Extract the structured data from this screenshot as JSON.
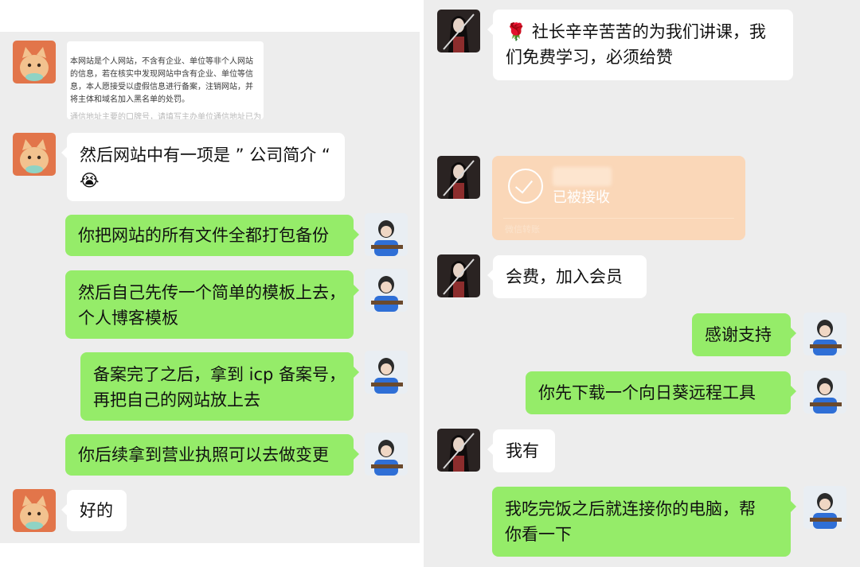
{
  "left_chat": {
    "quote_image": {
      "lines": [
        "本网站是个人网站，不含有企业、单位等非个人网站",
        "的信息，若在核实中发现网站中含有企业、单位等信",
        "息，本人愿接受以虚假信息进行备案，注销网站，并",
        "将主体和域名加入黑名单的处罚。"
      ],
      "faded_line": "通信地址主要的口牌号，请填写主办单位通信地址已为"
    },
    "messages": [
      {
        "lines": [
          "然后网站中有一项是 ” 公司简介 “",
          "😭"
        ]
      },
      {
        "lines": [
          "你把网站的所有文件全都打包备份"
        ]
      },
      {
        "lines": [
          "然后自己先传一个简单的模板上去，",
          "个人博客模板"
        ]
      },
      {
        "lines": [
          "备案完了之后，拿到 icp 备案号，",
          "再把自己的网站放上去"
        ]
      },
      {
        "lines": [
          "你后续拿到营业执照可以去做变更"
        ]
      },
      {
        "lines": [
          "好的"
        ]
      }
    ]
  },
  "right_chat": {
    "messages": [
      {
        "lines": [
          "🌹 社长辛辛苦苦的为我们讲课，我",
          "们免费学习，必须给赞"
        ]
      },
      {
        "lines": [
          "会费，加入会员"
        ]
      },
      {
        "lines": [
          "感谢支持"
        ]
      },
      {
        "lines": [
          "你先下载一个向日葵远程工具"
        ]
      },
      {
        "lines": [
          "我有"
        ]
      },
      {
        "lines": [
          "我吃完饭之后就连接你的电脑，帮",
          "你看一下"
        ]
      }
    ],
    "transfer_card": {
      "status": "已被接收",
      "footer": "微信转账"
    }
  },
  "colors": {
    "chat_background": "#ededed",
    "incoming_bubble": "#ffffff",
    "outgoing_bubble": "#95ec69",
    "transfer_card": "#fad7b8"
  }
}
